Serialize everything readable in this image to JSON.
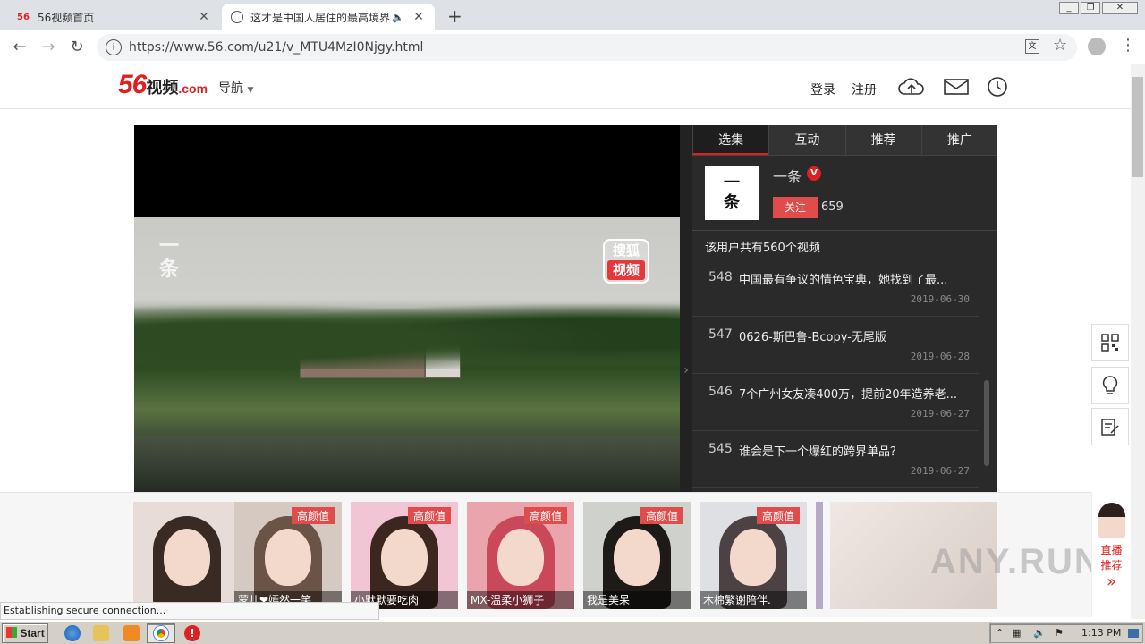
{
  "browser": {
    "tabs": [
      {
        "title": "56视频首页",
        "favicon": "56"
      },
      {
        "title": "这才是中国人居住的最高境界",
        "favicon": "globe-icon"
      }
    ],
    "new_tab": "+",
    "url": "https://www.56.com/u21/v_MTU4MzI0Njgy.html"
  },
  "site": {
    "logo_num": "56",
    "logo_text": "视频",
    "logo_sub": ".com",
    "nav_label": "导航",
    "login": "登录",
    "register": "注册"
  },
  "player": {
    "watermark": "一\n条",
    "sohu_top": "搜狐",
    "sohu_bottom": "视频"
  },
  "panel": {
    "tabs": [
      "选集",
      "互动",
      "推荐",
      "推广"
    ],
    "uploader": {
      "name": "一条",
      "avatar_text": "一\n条",
      "follow": "关注",
      "followers": "659"
    },
    "video_count": "该用户共有560个视频",
    "videos": [
      {
        "num": "548",
        "title": "中国最有争议的情色宝典，她找到了最...",
        "date": "2019-06-30"
      },
      {
        "num": "547",
        "title": "0626-斯巴鲁-Bcopy-无尾版",
        "date": "2019-06-28"
      },
      {
        "num": "546",
        "title": "7个广州女友凑400万，提前20年造养老...",
        "date": "2019-06-27"
      },
      {
        "num": "545",
        "title": "谁会是下一个爆红的跨界单品？",
        "date": "2019-06-27"
      }
    ]
  },
  "live": {
    "cards": [
      {
        "tag": "",
        "caption": ""
      },
      {
        "tag": "高颜值",
        "caption": "蒙儿❤嫣然一笑"
      },
      {
        "tag": "高颜值",
        "caption": "小默默要吃肉"
      },
      {
        "tag": "高颜值",
        "caption": "MX-温柔小狮子"
      },
      {
        "tag": "高颜值",
        "caption": "我是美呆"
      },
      {
        "tag": "高颜值",
        "caption": "木棉繁谢陪伴."
      }
    ],
    "side_label_1": "直播",
    "side_label_2": "推荐",
    "side_more": "»"
  },
  "status_text": "Establishing secure connection...",
  "watermark_text": "ANY.RUN",
  "taskbar": {
    "start": "Start",
    "time": "1:13 PM"
  },
  "colors": {
    "brand_red": "#e02020",
    "tag_red": "#e04c4c"
  }
}
